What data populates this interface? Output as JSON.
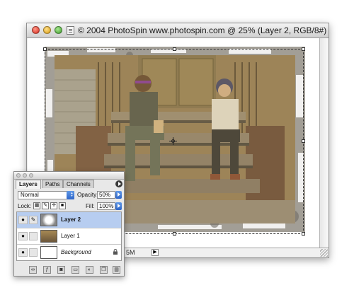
{
  "document_window": {
    "title": "© 2004 PhotoSpin www.photospin.com @ 25% (Layer 2, RGB/8#)",
    "status_zoom": "5M"
  },
  "layers_panel": {
    "tabs": [
      {
        "label": "Layers",
        "active": true
      },
      {
        "label": "Paths",
        "active": false
      },
      {
        "label": "Channels",
        "active": false
      }
    ],
    "blend_mode": "Normal",
    "opacity_label": "Opacity:",
    "opacity_value": "50%",
    "lock_label": "Lock:",
    "fill_label": "Fill:",
    "fill_value": "100%",
    "layers": [
      {
        "name": "Layer 2",
        "selected": true,
        "bold": true,
        "italic": false,
        "locked": false
      },
      {
        "name": "Layer 1",
        "selected": false,
        "bold": false,
        "italic": false,
        "locked": false
      },
      {
        "name": "Background",
        "selected": false,
        "bold": false,
        "italic": true,
        "locked": true
      }
    ],
    "bottom_buttons": [
      "link-layers",
      "layer-style",
      "add-mask",
      "new-set",
      "adjustment-layer",
      "new-layer",
      "delete-layer"
    ]
  },
  "colors": {
    "selected_layer": "#b7cdf0",
    "arrow_button": "#2f66c8"
  }
}
